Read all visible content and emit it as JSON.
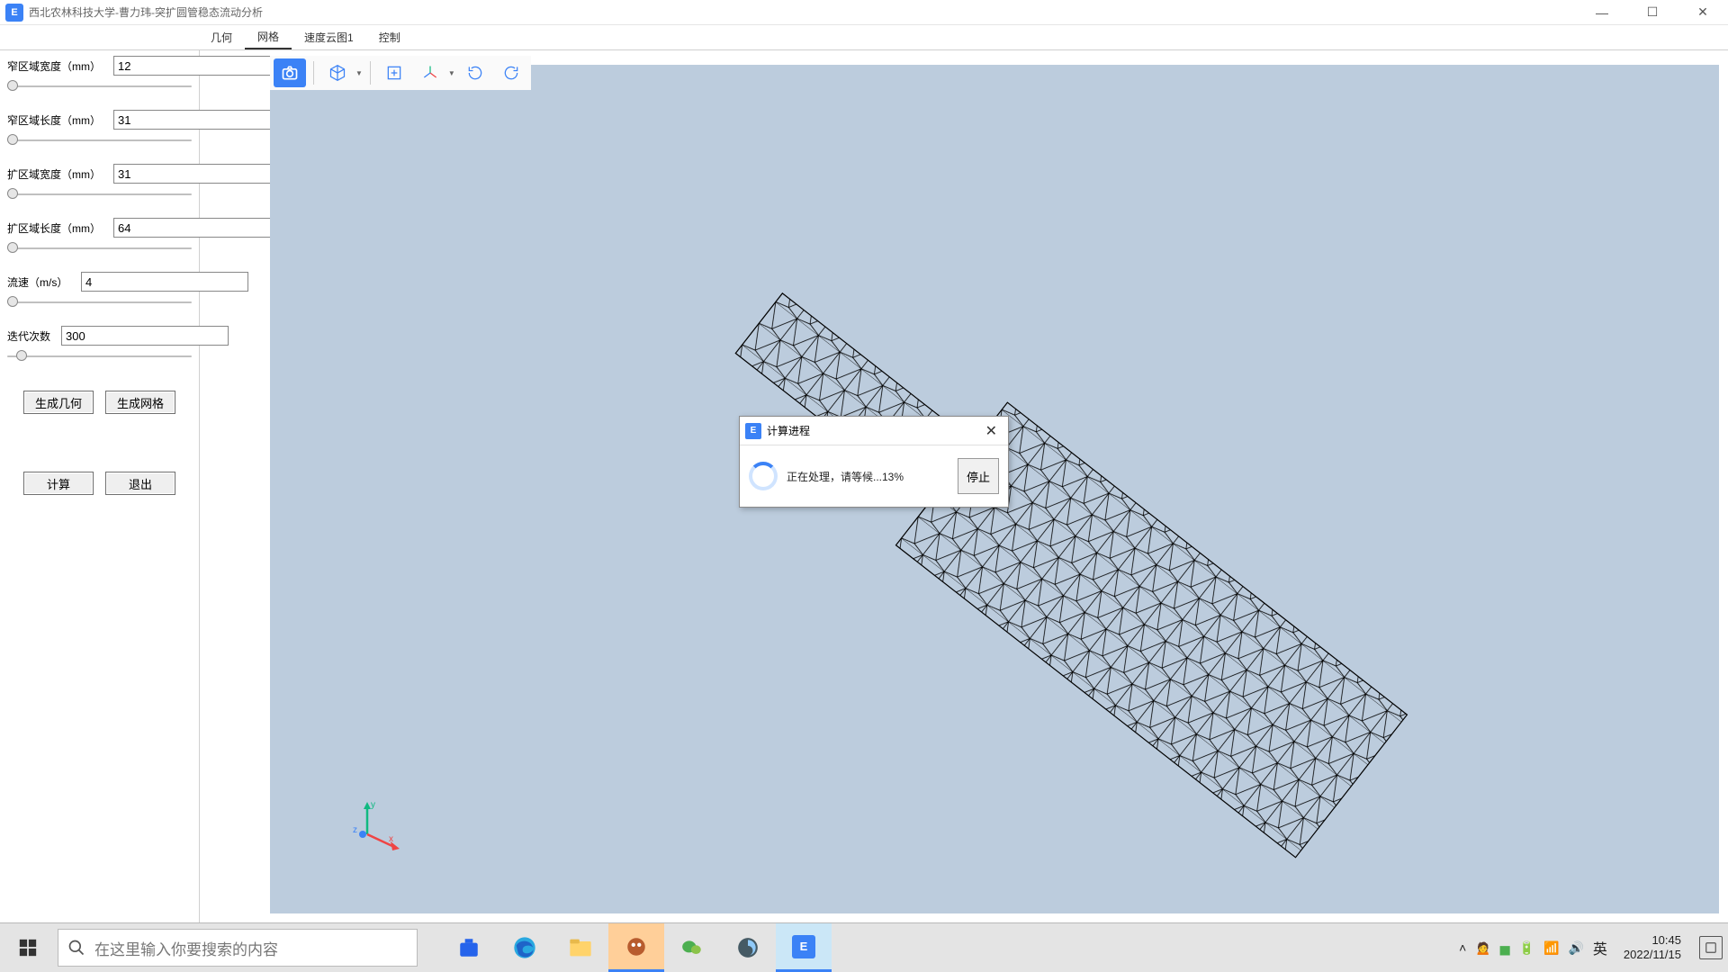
{
  "window": {
    "title": "西北农林科技大学-曹力玮-突扩圆管稳态流动分析",
    "icon_letter": "E"
  },
  "tabs": {
    "items": [
      {
        "label": "几何"
      },
      {
        "label": "网格"
      },
      {
        "label": "速度云图1"
      },
      {
        "label": "控制"
      }
    ],
    "active_index": 1
  },
  "params": [
    {
      "label": "窄区域宽度（mm）",
      "value": "12",
      "thumb_pct": 0
    },
    {
      "label": "窄区域长度（mm）",
      "value": "31",
      "thumb_pct": 0
    },
    {
      "label": "扩区域宽度（mm）",
      "value": "31",
      "thumb_pct": 0
    },
    {
      "label": "扩区域长度（mm）",
      "value": "64",
      "thumb_pct": 0
    },
    {
      "label": "流速（m/s）",
      "value": "4",
      "thumb_pct": 0,
      "label_narrow": false
    },
    {
      "label": "迭代次数",
      "value": "300",
      "thumb_pct": 5,
      "label_narrow": true
    }
  ],
  "buttons": {
    "generate_geometry": "生成几何",
    "generate_mesh": "生成网格",
    "compute": "计算",
    "exit": "退出"
  },
  "toolbar_icons": [
    "camera-icon",
    "cube-icon",
    "focus-icon",
    "axes-icon",
    "rotate-ccw-icon",
    "rotate-cw-icon"
  ],
  "triad": {
    "x": "x",
    "y": "y",
    "z": "z"
  },
  "dialog": {
    "title": "计算进程",
    "message": "正在处理，请等候...13%",
    "stop": "停止",
    "icon_letter": "E"
  },
  "taskbar": {
    "search_placeholder": "在这里输入你要搜索的内容",
    "ime": "英",
    "time": "10:45",
    "date": "2022/11/15",
    "tray_chevron": "˄"
  }
}
